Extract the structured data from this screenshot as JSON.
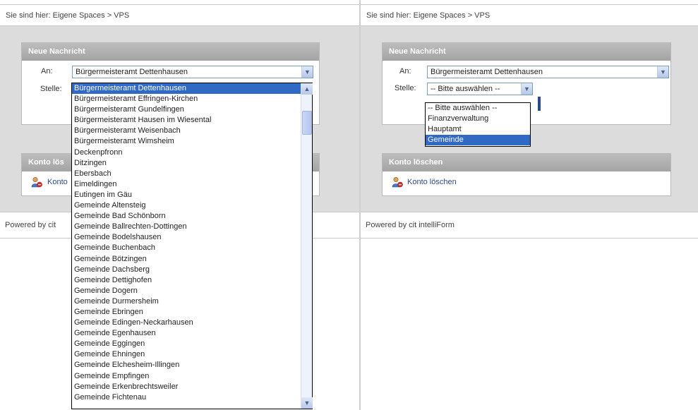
{
  "left": {
    "breadcrumb": "Sie sind hier: Eigene Spaces > VPS",
    "box_title": "Neue Nachricht",
    "an_label": "An:",
    "an_value": "Bürgermeisteramt Dettenhausen",
    "stelle_label": "Stelle:",
    "delete_box_title": "Konto lös",
    "delete_link": "Konto",
    "footer": "Powered by cit",
    "dropdown_options": [
      "Bürgermeisteramt Dettenhausen",
      "Bürgermeisteramt Effringen-Kirchen",
      "Bürgermeisteramt Gundelfingen",
      "Bürgermeisteramt Hausen im Wiesental",
      "Bürgermeisteramt Weisenbach",
      "Bürgermeisteramt Wimsheim",
      "Deckenpfronn",
      "Ditzingen",
      "Ebersbach",
      "Eimeldingen",
      "Eutingen im Gäu",
      "Gemeinde Altensteig",
      "Gemeinde Bad Schönborn",
      "Gemeinde Ballrechten-Dottingen",
      "Gemeinde Bodelshausen",
      "Gemeinde Buchenbach",
      "Gemeinde Bötzingen",
      "Gemeinde Dachsberg",
      "Gemeinde Dettighofen",
      "Gemeinde Dogern",
      "Gemeinde Durmersheim",
      "Gemeinde Ebringen",
      "Gemeinde Edingen-Neckarhausen",
      "Gemeinde Egenhausen",
      "Gemeinde Eggingen",
      "Gemeinde Ehningen",
      "Gemeinde Elchesheim-Illingen",
      "Gemeinde Empfingen",
      "Gemeinde Erkenbrechtsweiler",
      "Gemeinde Fichtenau"
    ],
    "selected_index": 0
  },
  "right": {
    "breadcrumb": "Sie sind hier: Eigene Spaces > VPS",
    "box_title": "Neue Nachricht",
    "an_label": "An:",
    "an_value": "Bürgermeisteramt Dettenhausen",
    "stelle_label": "Stelle:",
    "stelle_value": "-- Bitte auswählen --",
    "stelle_options": [
      "-- Bitte auswählen --",
      "Finanzverwaltung",
      "Hauptamt",
      "Gemeinde"
    ],
    "selected_index": 3,
    "delete_box_title": "Konto löschen",
    "delete_link": "Konto löschen",
    "footer": "Powered by cit intelliForm"
  },
  "colors": {
    "header_gray": "#a9a9a9",
    "page_gray": "#dcdcdc",
    "selection_blue": "#316ac5",
    "link_blue": "#2a4a8f"
  },
  "icons": {
    "dropdown_arrow": "chevron-down-icon",
    "scroll_up": "chevron-up-icon",
    "delete_user": "user-delete-icon"
  }
}
